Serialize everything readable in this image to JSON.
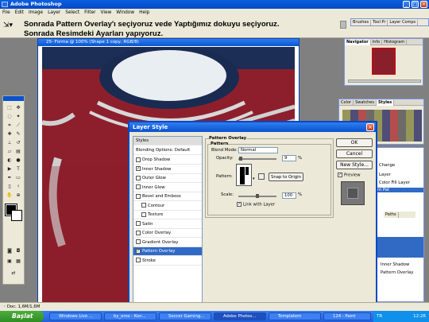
{
  "app": {
    "title": "Adobe Photoshop"
  },
  "menu": [
    "File",
    "Edit",
    "Image",
    "Layer",
    "Select",
    "Filter",
    "View",
    "Window",
    "Help"
  ],
  "annotation": {
    "line1": "Sonrada Pattern Overlay'ı seçiyoruz vede Yaptığımız dokuyu seçiyoruz.",
    "line2": "Sonrada Resimdeki Ayarları yapıyoruz."
  },
  "top_right_tabs": [
    "Brushes",
    "Tool Pr",
    "Layer Comps"
  ],
  "navigator_tabs": [
    "Navigator",
    "Info",
    "Histogram"
  ],
  "styles_tabs": [
    "Color",
    "Swatches",
    "Styles"
  ],
  "document": {
    "title": "25- Forma @ 100% (Shape 1 copy, RGB/8)"
  },
  "dialog": {
    "title": "Layer Style",
    "styles_header": "Styles",
    "blending": "Blending Options: Default",
    "effects": [
      {
        "label": "Drop Shadow",
        "checked": false,
        "indent": false
      },
      {
        "label": "Inner Shadow",
        "checked": true,
        "indent": false
      },
      {
        "label": "Outer Glow",
        "checked": false,
        "indent": false
      },
      {
        "label": "Inner Glow",
        "checked": false,
        "indent": false
      },
      {
        "label": "Bevel and Emboss",
        "checked": false,
        "indent": false
      },
      {
        "label": "Contour",
        "checked": false,
        "indent": true
      },
      {
        "label": "Texture",
        "checked": false,
        "indent": true
      },
      {
        "label": "Satin",
        "checked": false,
        "indent": false
      },
      {
        "label": "Color Overlay",
        "checked": false,
        "indent": false
      },
      {
        "label": "Gradient Overlay",
        "checked": false,
        "indent": false
      },
      {
        "label": "Pattern Overlay",
        "checked": true,
        "indent": false
      },
      {
        "label": "Stroke",
        "checked": false,
        "indent": false
      }
    ],
    "selected_effect": "Pattern Overlay",
    "group_title": "Pattern Overlay",
    "subgroup": "Pattern",
    "blend_mode_label": "Blend Mode:",
    "blend_mode_value": "Normal",
    "opacity_label": "Opacity:",
    "opacity_value": "9",
    "opacity_unit": "%",
    "pattern_label": "Pattern:",
    "snap_button": "Snap to Origin",
    "scale_label": "Scale:",
    "scale_value": "100",
    "scale_unit": "%",
    "link_label": "Link with Layer",
    "buttons": {
      "ok": "OK",
      "cancel": "Cancel",
      "new_style": "New Style..."
    },
    "preview_label": "Preview"
  },
  "layers_partial": [
    "Change",
    "Layer",
    "Color Fill Layer",
    "m Pat"
  ],
  "layers_bottom": [
    "Inner Shadow",
    "Pattern Overlay"
  ],
  "paths_tab": "Paths",
  "status": {
    "doc": "Doc: 1,6M/1,6M"
  },
  "taskbar": {
    "start": "Başlat",
    "tasks": [
      "Windows Live ...",
      "by_eros - Kon...",
      "Soccer Gaming...",
      "Adobe Photos...",
      "Templatem",
      "124 - Paint"
    ],
    "active": "Adobe Photos...",
    "lang": "TR",
    "clock": "12:26"
  }
}
